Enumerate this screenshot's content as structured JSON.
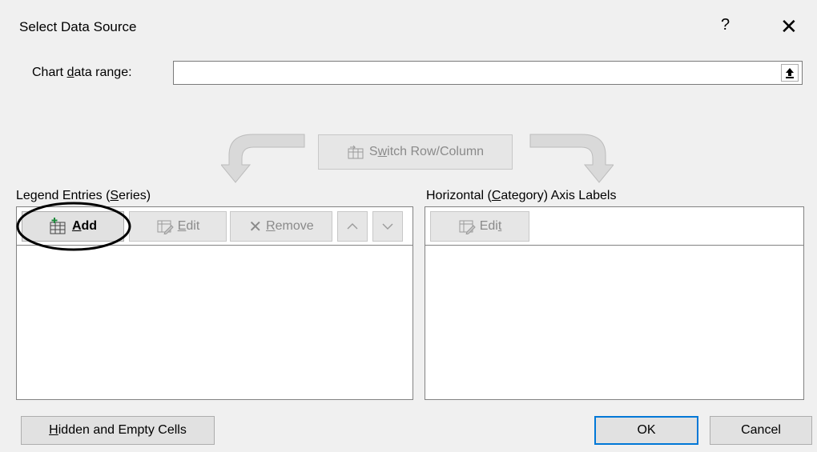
{
  "dialog": {
    "title": "Select Data Source",
    "help_label": "?",
    "close_label": "✕"
  },
  "range": {
    "label_pre": "Chart ",
    "label_access": "d",
    "label_post": "ata range:",
    "value": ""
  },
  "switch": {
    "pre": "S",
    "access": "w",
    "post": "itch Row/Column"
  },
  "legend": {
    "label_pre": "Legend Entries (",
    "label_access": "S",
    "label_post": "eries)",
    "add_access": "A",
    "add_post": "dd",
    "edit_access": "E",
    "edit_post": "dit",
    "remove_access": "R",
    "remove_post": "emove"
  },
  "axis": {
    "label_pre": "Horizontal (",
    "label_access": "C",
    "label_post": "ategory) Axis Labels",
    "edit_pre": "Edi",
    "edit_access": "t"
  },
  "footer": {
    "hidden_access": "H",
    "hidden_post": "idden and Empty Cells",
    "ok_label": "OK",
    "cancel_label": "Cancel"
  },
  "colors": {
    "accent": "#0078d7",
    "disabled_text": "#8a8a8a",
    "add_icon_green": "#1e8a3c"
  }
}
